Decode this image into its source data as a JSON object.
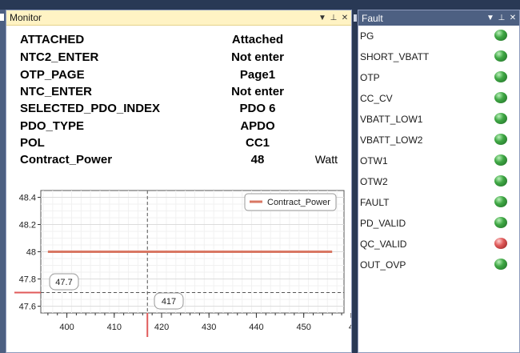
{
  "monitor": {
    "title": "Monitor",
    "rows": [
      {
        "key": "ATTACHED",
        "value": "Attached",
        "unit": ""
      },
      {
        "key": "NTC2_ENTER",
        "value": "Not enter",
        "unit": ""
      },
      {
        "key": "OTP_PAGE",
        "value": "Page1",
        "unit": ""
      },
      {
        "key": "NTC_ENTER",
        "value": "Not enter",
        "unit": ""
      },
      {
        "key": "SELECTED_PDO_INDEX",
        "value": "PDO 6",
        "unit": ""
      },
      {
        "key": "PDO_TYPE",
        "value": "APDO",
        "unit": ""
      },
      {
        "key": "POL",
        "value": "CC1",
        "unit": ""
      },
      {
        "key": "Contract_Power",
        "value": "48",
        "unit": "Watt"
      }
    ]
  },
  "fault": {
    "title": "Fault",
    "items": [
      {
        "label": "PG",
        "status": "green"
      },
      {
        "label": "SHORT_VBATT",
        "status": "green"
      },
      {
        "label": "OTP",
        "status": "green"
      },
      {
        "label": "CC_CV",
        "status": "green"
      },
      {
        "label": "VBATT_LOW1",
        "status": "green"
      },
      {
        "label": "VBATT_LOW2",
        "status": "green"
      },
      {
        "label": "OTW1",
        "status": "green"
      },
      {
        "label": "OTW2",
        "status": "green"
      },
      {
        "label": "FAULT",
        "status": "green"
      },
      {
        "label": "PD_VALID",
        "status": "green"
      },
      {
        "label": "QC_VALID",
        "status": "red"
      },
      {
        "label": "OUT_OVP",
        "status": "green"
      }
    ]
  },
  "header_icons": [
    "dropdown-icon",
    "pin-icon",
    "close-icon"
  ],
  "chart_data": {
    "type": "line",
    "series": [
      {
        "name": "Contract_Power",
        "color": "#d97763",
        "points": [
          [
            396,
            48
          ],
          [
            456,
            48
          ]
        ]
      }
    ],
    "xlim": [
      394.5,
      458.5
    ],
    "ylim": [
      47.55,
      48.45
    ],
    "x_ticks": [
      400,
      410,
      420,
      430,
      440,
      450
    ],
    "x_tick_labels": [
      "400",
      "410",
      "420",
      "430",
      "440",
      "450",
      "4"
    ],
    "y_ticks": [
      47.6,
      47.8,
      48,
      48.2,
      48.4
    ],
    "y_tick_labels": [
      "47.6",
      "47.8",
      "48",
      "48.2",
      "48.4"
    ],
    "crosshair": {
      "x": 417,
      "y": 47.7,
      "x_label": "417",
      "y_label": "47.7"
    },
    "legend_placement": "top-right",
    "grid": true
  },
  "colors": {
    "monitor_header": "#fff3c4",
    "fault_header": "#4d6082",
    "background": "#293955",
    "line": "#d97763"
  }
}
